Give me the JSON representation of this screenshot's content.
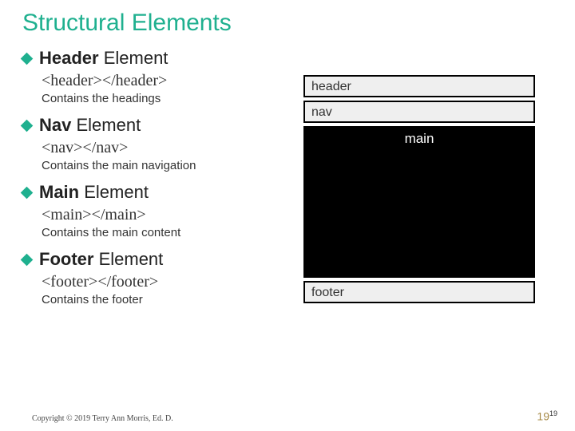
{
  "title": "Structural Elements",
  "sections": [
    {
      "bullet_strong": "Header",
      "bullet_rest": " Element",
      "code": "<header></header>",
      "desc": "Contains the headings"
    },
    {
      "bullet_strong": "Nav",
      "bullet_rest": " Element",
      "code": "<nav></nav>",
      "desc": "Contains the main navigation"
    },
    {
      "bullet_strong": "Main",
      "bullet_rest": " Element",
      "code": "<main></main>",
      "desc": "Contains the main content"
    },
    {
      "bullet_strong": "Footer",
      "bullet_rest": " Element",
      "code": "<footer></footer>",
      "desc": "Contains the  footer"
    }
  ],
  "diagram": {
    "header": "header",
    "nav": "nav",
    "main": "main",
    "footer": "footer"
  },
  "copyright": "Copyright © 2019 Terry Ann Morris, Ed. D.",
  "page": {
    "big": "19",
    "small": "19"
  }
}
